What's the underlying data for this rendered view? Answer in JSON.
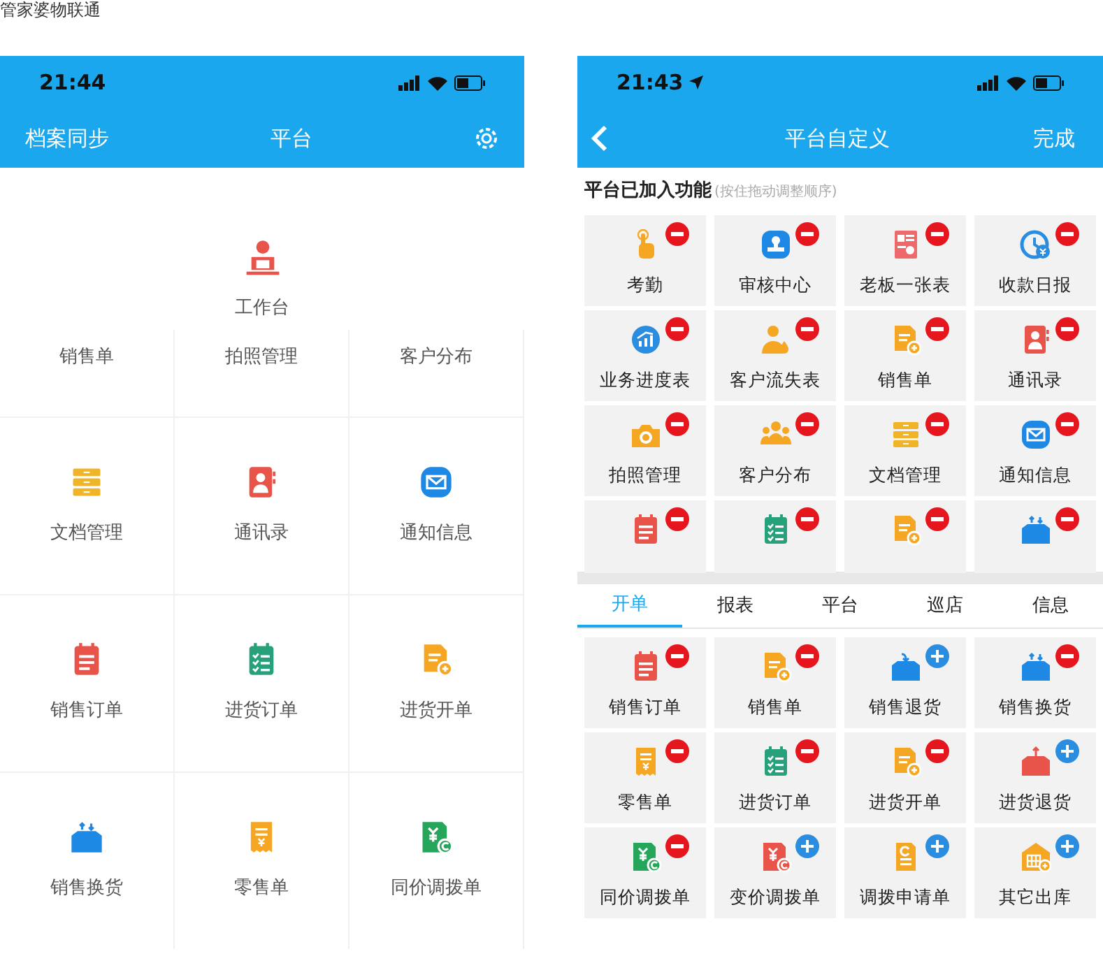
{
  "caption": "管家婆物联通",
  "left_phone": {
    "status_bar": {
      "time": "21:44"
    },
    "nav": {
      "left": "档案同步",
      "title": "平台"
    },
    "featured": {
      "label": "工作台",
      "kind": "desk"
    },
    "grid": [
      {
        "label": "销售单"
      },
      {
        "label": "拍照管理"
      },
      {
        "label": "客户分布"
      },
      {
        "label": "文档管理",
        "kind": "stack"
      },
      {
        "label": "通讯录",
        "kind": "contacts"
      },
      {
        "label": "通知信息",
        "kind": "mail"
      },
      {
        "label": "销售订单",
        "kind": "order"
      },
      {
        "label": "进货订单",
        "kind": "checklist"
      },
      {
        "label": "进货开单",
        "kind": "docplus"
      },
      {
        "label": "销售换货",
        "kind": "boxswap"
      },
      {
        "label": "零售单",
        "kind": "receipt"
      },
      {
        "label": "同价调拨单",
        "kind": "yen"
      }
    ]
  },
  "right_phone": {
    "status_bar": {
      "time": "21:43"
    },
    "nav": {
      "title": "平台自定义",
      "done": "完成"
    },
    "section": {
      "title": "平台已加入功能",
      "hint": "(按住拖动调整顺序)"
    },
    "added": [
      {
        "label": "考勤",
        "kind": "hand",
        "added": true
      },
      {
        "label": "审核中心",
        "kind": "stamp",
        "added": true
      },
      {
        "label": "老板一张表",
        "kind": "report",
        "added": true
      },
      {
        "label": "收款日报",
        "kind": "clock",
        "added": true
      },
      {
        "label": "业务进度表",
        "kind": "chart",
        "added": true
      },
      {
        "label": "客户流失表",
        "kind": "persondrop",
        "added": true
      },
      {
        "label": "销售单",
        "kind": "docplus",
        "added": true
      },
      {
        "label": "通讯录",
        "kind": "contacts",
        "added": true
      },
      {
        "label": "拍照管理",
        "kind": "camera",
        "added": true
      },
      {
        "label": "客户分布",
        "kind": "group",
        "added": true
      },
      {
        "label": "文档管理",
        "kind": "stack",
        "added": true
      },
      {
        "label": "通知信息",
        "kind": "mail",
        "added": true
      },
      {
        "kind": "order",
        "added": true
      },
      {
        "kind": "checklist",
        "added": true
      },
      {
        "kind": "docplus",
        "added": true
      },
      {
        "kind": "boxswap",
        "added": true
      }
    ],
    "tabs": [
      {
        "label": "开单",
        "selected": true
      },
      {
        "label": "报表",
        "selected": false
      },
      {
        "label": "平台",
        "selected": false
      },
      {
        "label": "巡店",
        "selected": false
      },
      {
        "label": "信息",
        "selected": false
      }
    ],
    "available": [
      {
        "label": "销售订单",
        "kind": "order",
        "added": true
      },
      {
        "label": "销售单",
        "kind": "docplus",
        "added": true
      },
      {
        "label": "销售退货",
        "kind": "boxin",
        "added": false
      },
      {
        "label": "销售换货",
        "kind": "boxswap",
        "added": true
      },
      {
        "label": "零售单",
        "kind": "receipt",
        "added": true
      },
      {
        "label": "进货订单",
        "kind": "checklist",
        "added": true
      },
      {
        "label": "进货开单",
        "kind": "docplus",
        "added": true
      },
      {
        "label": "进货退货",
        "kind": "boxout",
        "added": false
      },
      {
        "label": "同价调拨单",
        "kind": "yen",
        "added": true
      },
      {
        "label": "变价调拨单",
        "kind": "yenred",
        "added": false
      },
      {
        "label": "调拨申请单",
        "kind": "docc",
        "added": false
      },
      {
        "label": "其它出库",
        "kind": "warehouse",
        "added": false
      }
    ]
  }
}
